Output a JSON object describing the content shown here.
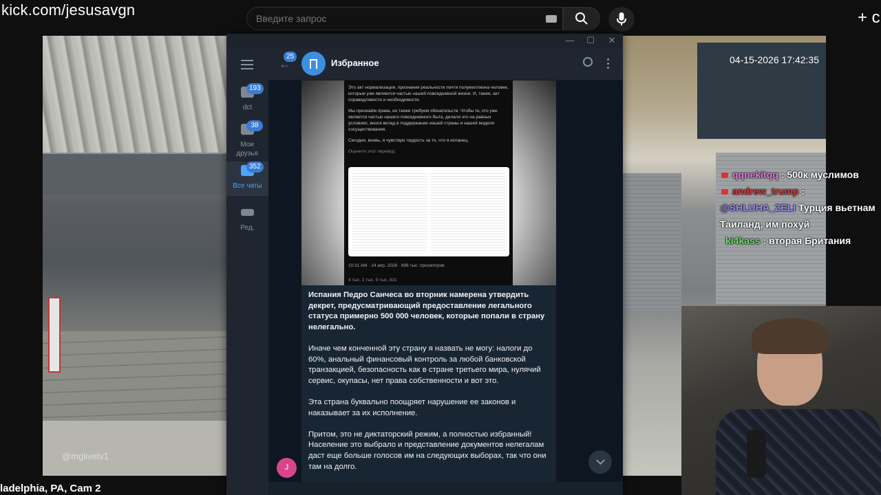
{
  "stream": {
    "url": "kick.com/jesusavgn",
    "cam_label": "ladelphia, PA, Cam 2",
    "timestamp": "04-15-2026 17:42:35",
    "watermark": "@mglivetv1"
  },
  "browser": {
    "search_placeholder": "Введите запрос",
    "create_icon": "+ c"
  },
  "chat": {
    "messages": [
      {
        "user": "qqnekitqq",
        "text": ": 500к муслимов"
      },
      {
        "user": "andrew_trump",
        "text": ":"
      },
      {
        "user": "@SHLUHA_ZELI",
        "text": "Турция вьетнам"
      },
      {
        "user": "",
        "text": "Таиланд, им похуй"
      },
      {
        "user": "ki4kass",
        "text": ": вторая Британия"
      }
    ]
  },
  "telegram": {
    "sidebar": [
      {
        "label": "dct",
        "count": "193"
      },
      {
        "label": "Мои друзья",
        "count": "38"
      },
      {
        "label": "Все чаты",
        "count": "352"
      },
      {
        "label": "Ред.",
        "count": ""
      }
    ],
    "back_badge": "25",
    "chat_title": "Избранное",
    "screenshot": {
      "para1": "Это акт нормализации, признания реальности почти полумиллиона человек, которые уже являются частью нашей повседневной жизни. И, также, акт справедливости и необходимости.",
      "para2": "Мы признаём права, но также требуем обязательств. Чтобы те, кто уже является частью нашего повседневного быта, делали это на равных условиях, внося вклад в поддержание нашей страны и нашей модели сосуществования.",
      "para3": "Сегодня, вновь, я чувствую гордость за то, что я испанец.",
      "rate": "Оцените этот перевод:",
      "meta": "10:31 AM · 14 апр. 2026 · 896 тыс. просмотров",
      "actions": "4 тыс.   2 тыс.   9 тыс.   931"
    },
    "message": {
      "bold": "Испания Педро Санчеса во вторник намерена утвердить декрет, предусматривающий предоставление легального статуса примерно 500 000 человек, которые попали в страну нелегально.",
      "p2": "Иначе чем конченной эту страну я назвать не могу: налоги до 60%, анальный финансовый контроль за любой банковской транзакцией, безопасность как в стране третьего мира, нулячий сервис, окупасы, нет права собственности и вот это.",
      "p3": "Эта страна буквально поощряет нарушение ее законов и наказывает за их исполнение.",
      "p4": "Притом, это не диктаторский режим, а полностью избранный! Население это выбрало и представление документов нелегалам даст еще больше голосов им на следующих выборах, так что они там на долго."
    },
    "user_avatar_letter": "J"
  },
  "colors": {
    "accent": "#3a7bd5",
    "chat_user_1": "#e07ee0",
    "chat_user_2": "#d23b3b",
    "chat_user_3": "#9a8cf0",
    "chat_user_4": "#6ee06a"
  }
}
